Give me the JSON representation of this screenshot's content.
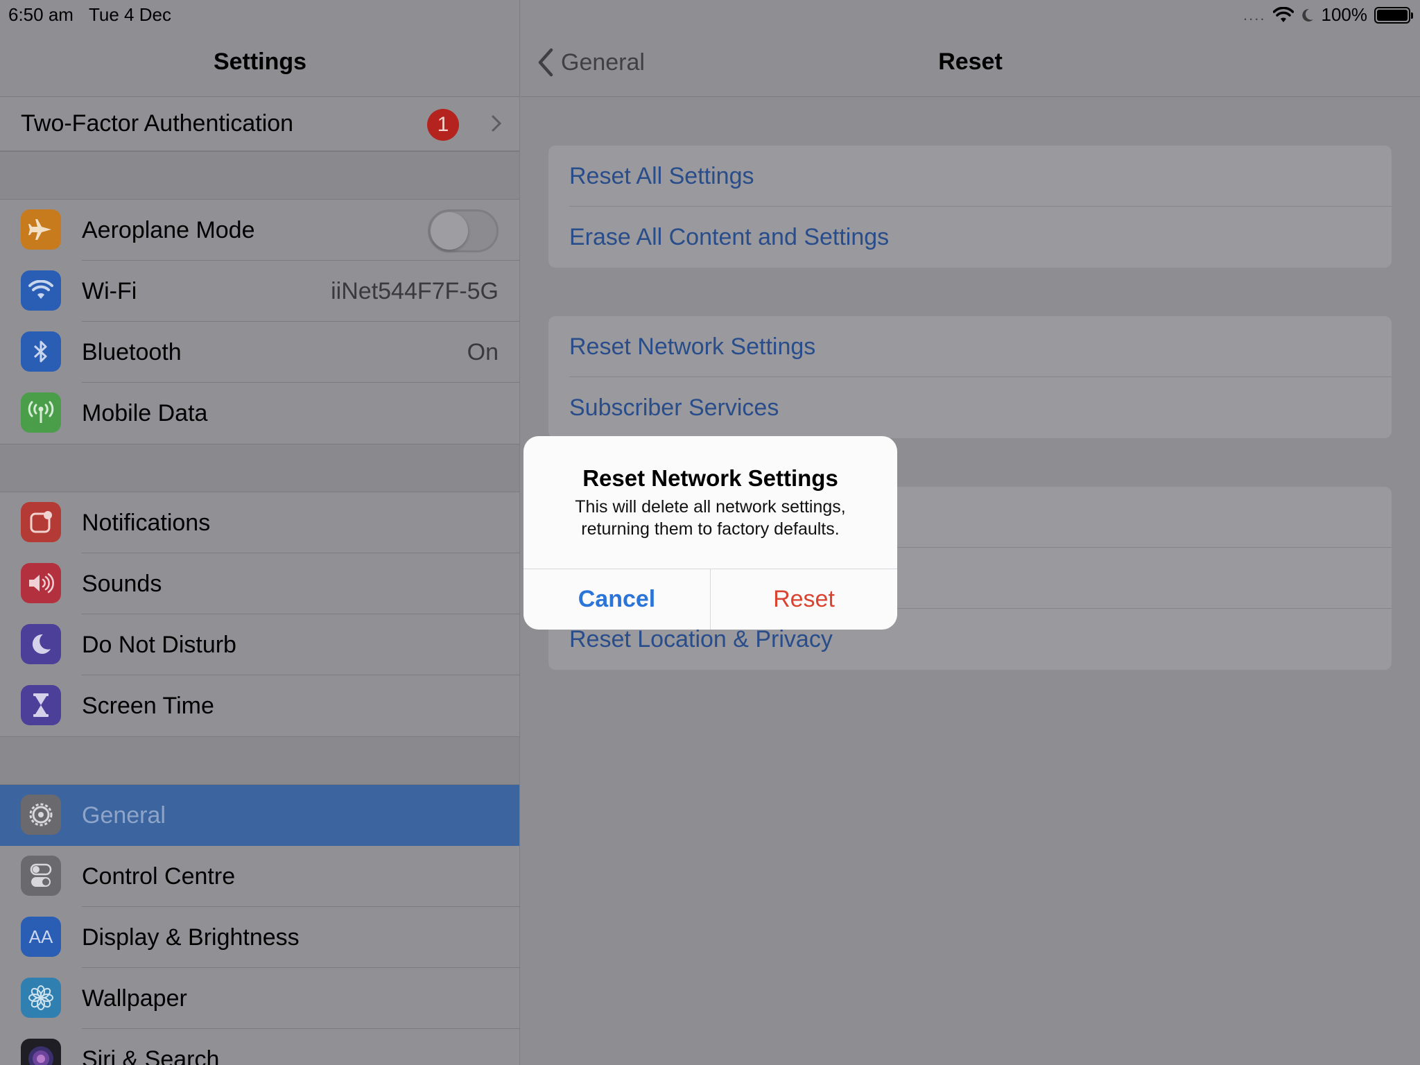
{
  "status_bar": {
    "time": "6:50 am",
    "date": "Tue 4 Dec",
    "signal": "....",
    "battery_percent": "100%"
  },
  "sidebar": {
    "title": "Settings",
    "two_factor": {
      "label": "Two-Factor Authentication",
      "badge": "1"
    },
    "group1": [
      {
        "label": "Aeroplane Mode",
        "icon": "airplane-icon",
        "color": "#c77b1c",
        "toggle": false
      },
      {
        "label": "Wi-Fi",
        "icon": "wifi-icon",
        "color": "#2a5eb5",
        "value": "iiNet544F7F-5G"
      },
      {
        "label": "Bluetooth",
        "icon": "bluetooth-icon",
        "color": "#2a5eb5",
        "value": "On"
      },
      {
        "label": "Mobile Data",
        "icon": "antenna-icon",
        "color": "#4a9e4a"
      }
    ],
    "group2": [
      {
        "label": "Notifications",
        "icon": "notifications-icon",
        "color": "#b43a35"
      },
      {
        "label": "Sounds",
        "icon": "speaker-icon",
        "color": "#b3313f"
      },
      {
        "label": "Do Not Disturb",
        "icon": "moon-icon",
        "color": "#4b3f99"
      },
      {
        "label": "Screen Time",
        "icon": "hourglass-icon",
        "color": "#4b3f99"
      }
    ],
    "group3": [
      {
        "label": "General",
        "icon": "gear-icon",
        "color": "#6a6a6e",
        "selected": true
      },
      {
        "label": "Control Centre",
        "icon": "switches-icon",
        "color": "#6a6a6e"
      },
      {
        "label": "Display & Brightness",
        "icon": "text-size-icon",
        "color": "#2a5eb5",
        "glyph": "AA"
      },
      {
        "label": "Wallpaper",
        "icon": "flower-icon",
        "color": "#2f7fb0"
      },
      {
        "label": "Siri & Search",
        "icon": "siri-icon",
        "color": "#222"
      }
    ]
  },
  "detail": {
    "back_label": "General",
    "title": "Reset",
    "card1": [
      "Reset All Settings",
      "Erase All Content and Settings"
    ],
    "card2": [
      "Reset Network Settings",
      "Subscriber Services"
    ],
    "card3": [
      "",
      "",
      "Reset Location & Privacy"
    ]
  },
  "alert": {
    "title": "Reset Network Settings",
    "message_line1": "This will delete all network settings,",
    "message_line2": "returning them to factory defaults.",
    "cancel_label": "Cancel",
    "reset_label": "Reset"
  },
  "colors": {
    "link_blue": "#284d8a",
    "alert_cancel": "#2b74d8",
    "alert_destructive": "#d9432f",
    "badge_red": "#b5231e",
    "selection": "#3c65a0"
  }
}
